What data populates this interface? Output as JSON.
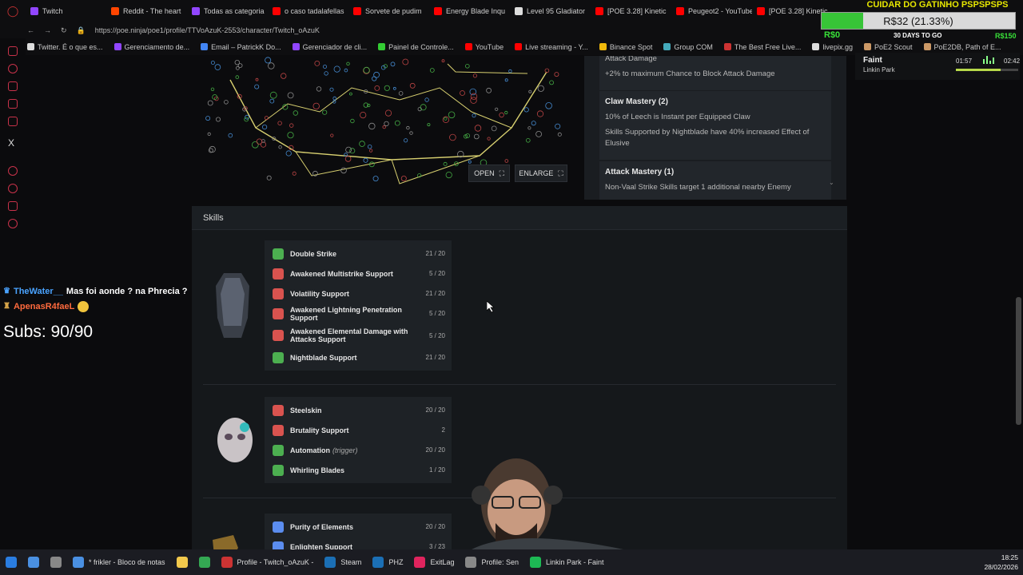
{
  "browser": {
    "tabs": [
      {
        "label": "Twitch",
        "color": "#9146ff"
      },
      {
        "label": "Reddit - The heart",
        "color": "#ff4500"
      },
      {
        "label": "Todas as categoria",
        "color": "#9146ff"
      },
      {
        "label": "o caso tadalafellas",
        "color": "#ff0000"
      },
      {
        "label": "Sorvete de pudim",
        "color": "#ff0000"
      },
      {
        "label": "Energy Blade Inqu",
        "color": "#ff0000"
      },
      {
        "label": "Level 95 Gladiator",
        "color": "#dddddd"
      },
      {
        "label": "[POE 3.28] Kinetic",
        "color": "#ff0000"
      },
      {
        "label": "Peugeot2 - YouTube",
        "color": "#ff0000"
      },
      {
        "label": "[POE 3.28] Kinetic",
        "color": "#ff0000"
      }
    ],
    "url": "https://poe.ninja/poe1/profile/TTVoAzuK-2553/character/Twitch_oAzuK",
    "bookmarks": [
      {
        "label": "Twitter. É o que es...",
        "color": "#dddddd"
      },
      {
        "label": "Gerenciamento de...",
        "color": "#9146ff"
      },
      {
        "label": "Email – PatrickK Do...",
        "color": "#4285f4"
      },
      {
        "label": "Gerenciador de cli...",
        "color": "#9146ff"
      },
      {
        "label": "Painel de Controle...",
        "color": "#33cc33"
      },
      {
        "label": "YouTube",
        "color": "#ff0000"
      },
      {
        "label": "Live streaming - Y...",
        "color": "#ff0000"
      },
      {
        "label": "Binance Spot",
        "color": "#f0b90b"
      },
      {
        "label": "Group COM",
        "color": "#4ab"
      },
      {
        "label": "The Best Free Live...",
        "color": "#cc3333"
      },
      {
        "label": "livepix.gg",
        "color": "#dddddd"
      },
      {
        "label": "PoE2 Scout",
        "color": "#c96"
      },
      {
        "label": "PoE2DB, Path of E...",
        "color": "#c96"
      }
    ]
  },
  "overlay": {
    "banner": "CUIDAR DO GATINHO PSPSPSPS",
    "goal_text": "R$32 (21.33%)",
    "goal_fraction": 0.2133,
    "goal_min": "R$0",
    "goal_mid": "30 DAYS TO GO",
    "goal_max": "R$150",
    "music": {
      "song": "Faint",
      "artist": "Linkin Park",
      "elapsed": "01:57",
      "total": "02:42",
      "progress": 0.72
    },
    "chat": [
      {
        "user": "TheWater__",
        "message": "Mas foi aonde ? na Phrecia ?",
        "color": "#4aa3ff"
      },
      {
        "user": "ApenasR4faeL",
        "message": "",
        "color": "#ff6a3d"
      }
    ],
    "subs": "Subs: 90/90"
  },
  "page": {
    "tree_buttons": {
      "open": "OPEN",
      "enlarge": "ENLARGE"
    },
    "masteries": [
      {
        "title": "",
        "lines": [
          "Attack Damage",
          "+2% to maximum Chance to Block Attack Damage"
        ]
      },
      {
        "title": "Claw Mastery (2)",
        "lines": [
          "10% of Leech is Instant per Equipped Claw",
          "Skills Supported by Nightblade have 40% increased Effect of Elusive"
        ]
      },
      {
        "title": "Attack Mastery (1)",
        "lines": [
          "Non-Vaal Strike Skills target 1 additional nearby Enemy"
        ]
      }
    ],
    "skills_title": "Skills",
    "skill_groups": [
      {
        "item": "body-armour",
        "gems": [
          {
            "name": "Double Strike",
            "level": "21 / 20",
            "color": "#4caf50"
          },
          {
            "name": "Awakened Multistrike Support",
            "level": "5 / 20",
            "color": "#d9534f"
          },
          {
            "name": "Volatility Support",
            "level": "21 / 20",
            "color": "#d9534f"
          },
          {
            "name": "Awakened Lightning Penetration Support",
            "level": "5 / 20",
            "color": "#d9534f"
          },
          {
            "name": "Awakened Elemental Damage with Attacks Support",
            "level": "5 / 20",
            "color": "#d9534f"
          },
          {
            "name": "Nightblade Support",
            "level": "21 / 20",
            "color": "#4caf50"
          }
        ]
      },
      {
        "item": "helmet",
        "gems": [
          {
            "name": "Steelskin",
            "level": "20 / 20",
            "color": "#d9534f"
          },
          {
            "name": "Brutality Support",
            "level": "2",
            "color": "#d9534f"
          },
          {
            "name": "Automation",
            "tag": "(trigger)",
            "level": "20 / 20",
            "color": "#4caf50"
          },
          {
            "name": "Whirling Blades",
            "level": "1 / 20",
            "color": "#4caf50"
          }
        ]
      },
      {
        "item": "gloves",
        "gems": [
          {
            "name": "Purity of Elements",
            "level": "20 / 20",
            "color": "#5b8def"
          },
          {
            "name": "Enlighten Support",
            "level": "3 / 23",
            "color": "#5b8def"
          }
        ]
      }
    ]
  },
  "taskbar": {
    "items": [
      {
        "label": "",
        "color": "#2a7de1"
      },
      {
        "label": "",
        "color": "#4a90e2"
      },
      {
        "label": "",
        "color": "#888888"
      },
      {
        "label": "* frikler - Bloco de notas",
        "color": "#4a90e2"
      },
      {
        "label": "",
        "color": "#f2c94c"
      },
      {
        "label": "",
        "color": "#34a853"
      },
      {
        "label": "Profile - Twitch_oAzuK -",
        "color": "#c33"
      },
      {
        "label": "Steam",
        "color": "#1b6fb5"
      },
      {
        "label": "PHZ",
        "color": "#1b6fb5"
      },
      {
        "label": "ExitLag",
        "color": "#e0245e"
      },
      {
        "label": "Profile: Sen",
        "color": "#888888"
      },
      {
        "label": "Linkin Park - Faint",
        "color": "#1db954"
      }
    ],
    "time": "18:25",
    "date": "28/02/2026"
  }
}
